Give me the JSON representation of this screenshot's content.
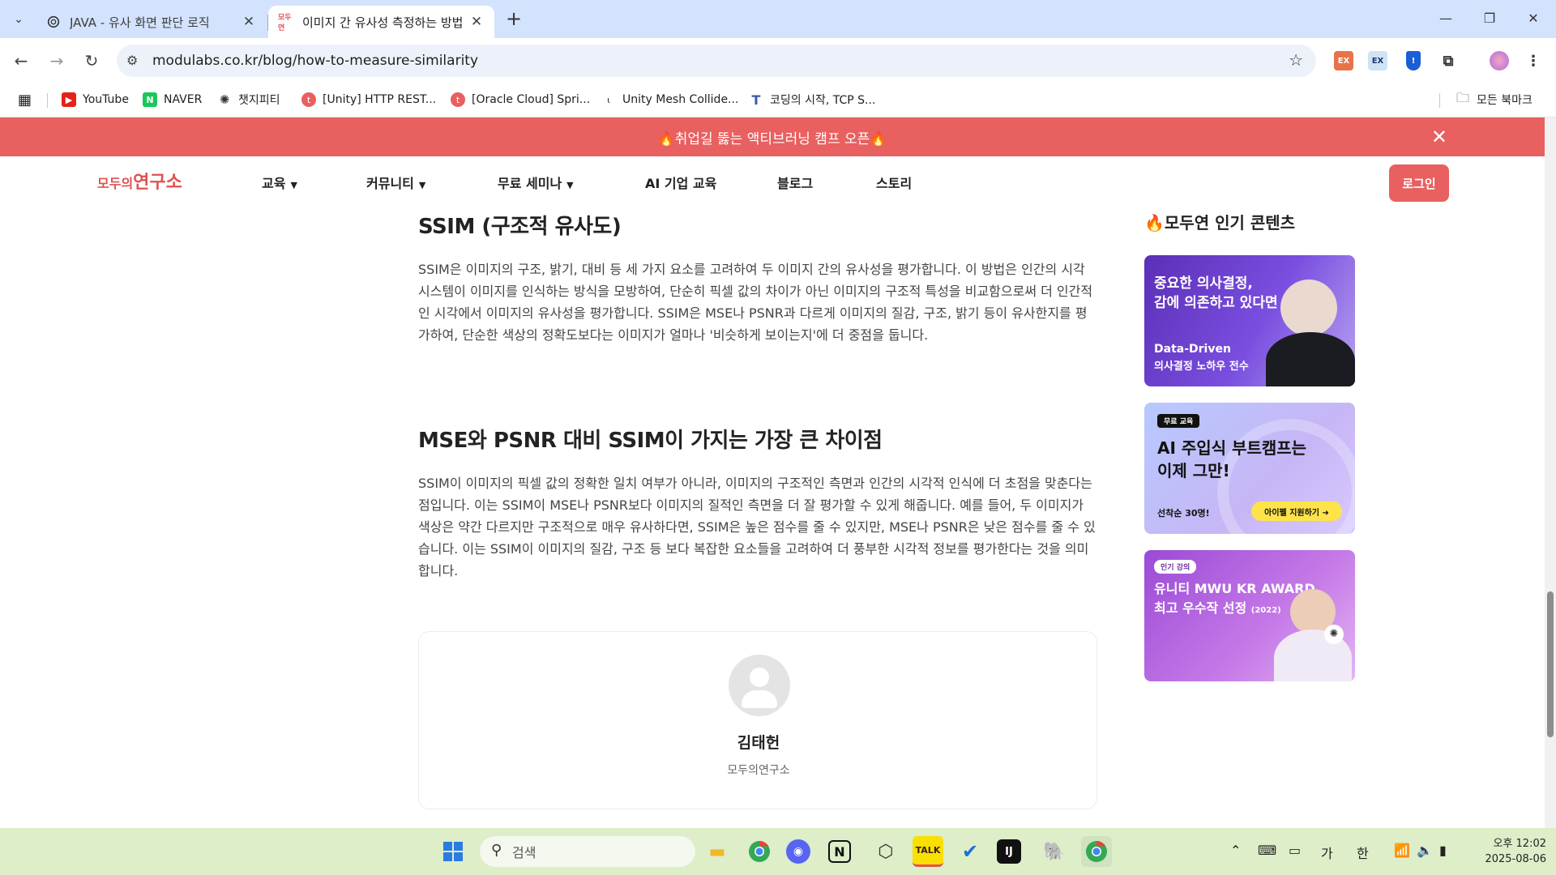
{
  "browser": {
    "tabs": [
      {
        "title": "JAVA - 유사 화면 판단 로직",
        "active": false
      },
      {
        "title": "이미지 간 유사성 측정하는 방법",
        "active": true
      }
    ],
    "url": "modulabs.co.kr/blog/how-to-measure-similarity",
    "new_tab_symbol": "+",
    "extensions": [
      "EX",
      "EX"
    ]
  },
  "bookmarks": [
    {
      "label": "YouTube",
      "icon": "youtube-icon"
    },
    {
      "label": "NAVER",
      "icon": "naver-icon"
    },
    {
      "label": "챗지피티",
      "icon": "openai-icon"
    },
    {
      "label": "[Unity] HTTP REST...",
      "icon": "site-icon"
    },
    {
      "label": "[Oracle Cloud] Spri...",
      "icon": "site-icon"
    },
    {
      "label": "Unity Mesh Collide...",
      "icon": "site-icon"
    },
    {
      "label": "코딩의 시작, TCP S...",
      "icon": "tistory-icon"
    }
  ],
  "bookmarks_all": "모든 북마크",
  "site": {
    "promo_banner": "🔥취업길 뚫는 액티브러닝 캠프 오픈🔥",
    "logo_small": "모두의",
    "logo_big": "연구소",
    "nav": [
      {
        "label": "교육",
        "dropdown": true
      },
      {
        "label": "커뮤니티",
        "dropdown": true
      },
      {
        "label": "무료 세미나",
        "dropdown": true
      },
      {
        "label": "AI 기업 교육",
        "dropdown": false
      },
      {
        "label": "블로그",
        "dropdown": false
      },
      {
        "label": "스토리",
        "dropdown": false
      }
    ],
    "login": "로그인"
  },
  "article": {
    "heading1": "SSIM (구조적 유사도)",
    "para1": "SSIM은 이미지의 구조, 밝기, 대비 등 세 가지 요소를 고려하여 두 이미지 간의 유사성을 평가합니다. 이 방법은 인간의 시각 시스템이 이미지를 인식하는 방식을 모방하여, 단순히 픽셀 값의 차이가 아닌 이미지의 구조적 특성을 비교함으로써 더 인간적인 시각에서 이미지의 유사성을 평가합니다. SSIM은 MSE나 PSNR과 다르게 이미지의 질감, 구조, 밝기 등이 유사한지를 평가하여, 단순한 색상의 정확도보다는 이미지가 얼마나 '비슷하게 보이는지'에 더 중점을 둡니다.",
    "heading2": "MSE와 PSNR 대비 SSIM이 가지는 가장 큰 차이점",
    "para2": "SSIM이 이미지의 픽셀 값의 정확한 일치 여부가 아니라, 이미지의 구조적인 측면과 인간의 시각적 인식에 더 초점을 맞춘다는 점입니다. 이는 SSIM이 MSE나 PSNR보다 이미지의 질적인 측면을 더 잘 평가할 수 있게 해줍니다. 예를 들어, 두 이미지가 색상은 약간 다르지만 구조적으로 매우 유사하다면, SSIM은 높은 점수를 줄 수 있지만, MSE나 PSNR은 낮은 점수를 줄 수 있습니다. 이는 SSIM이 이미지의 질감, 구조 등 보다 복잡한 요소들을 고려하여 더 풍부한 시각적 정보를 평가한다는 것을 의미합니다.",
    "author_name": "김태헌",
    "author_org": "모두의연구소"
  },
  "sidebar": {
    "title": "🔥모두연 인기 콘텐츠",
    "cards": [
      {
        "line1": "중요한 의사결정,",
        "line2": "감에 의존하고 있다면",
        "sub1": "Data-Driven",
        "sub2": "의사결정 노하우 전수"
      },
      {
        "chip": "무료 교육",
        "line1": "AI 주입식 부트캠프는",
        "line2": "이제 그만!",
        "foot": "선착순 30명!",
        "cta": "아이펠 지원하기 ➜"
      },
      {
        "chip": "인기 강의",
        "line1": "유니티 MWU KR AWARD",
        "line2": "최고 우수작 선정",
        "year": "(2022)"
      }
    ]
  },
  "taskbar": {
    "search_placeholder": "검색",
    "tray": [
      "가",
      "한"
    ],
    "clock_time": "오후 12:02",
    "clock_date": "2025-08-06"
  },
  "colors": {
    "brand": "#e8605f",
    "tabstrip": "#d3e3fd",
    "taskbar": "#ddeec9"
  }
}
